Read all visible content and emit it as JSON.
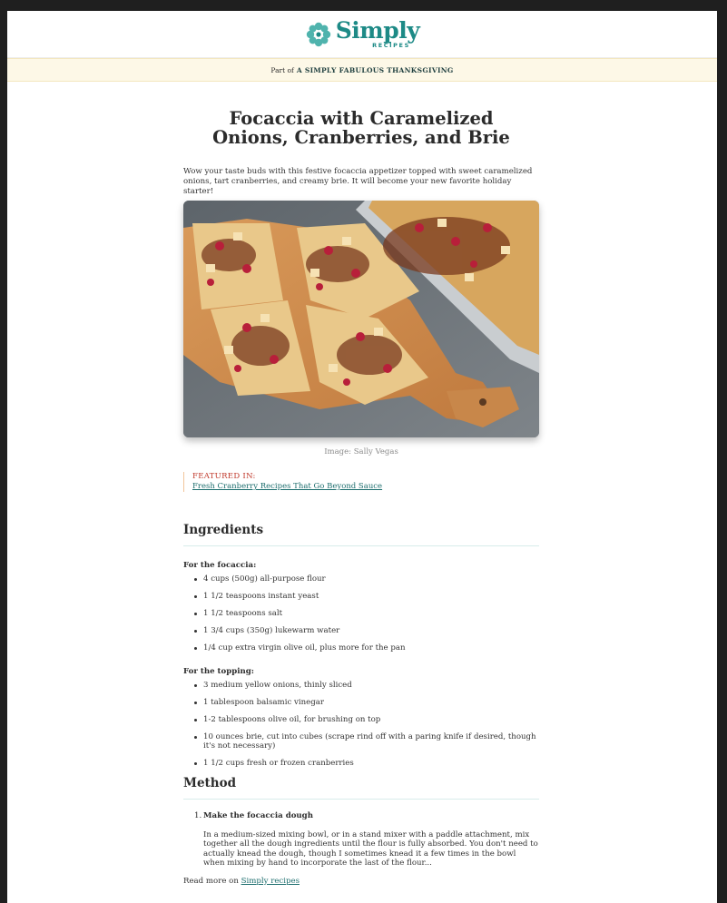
{
  "brand": {
    "name": "Simply",
    "sub": "RECIPES",
    "color": "#1d8a86"
  },
  "banner": {
    "prefix": "Part of",
    "link": "A SIMPLY FABULOUS THANKSGIVING"
  },
  "article": {
    "title": "Focaccia with Caramelized Onions, Cranberries, and Brie",
    "intro": "Wow your taste buds with this festive focaccia appetizer topped with sweet caramelized onions, tart cranberries, and creamy brie. It will become your new favorite holiday starter!",
    "image_credit": "Image: Sally Vegas",
    "featured_label": "FEATURED IN:",
    "featured_link": "Fresh Cranberry Recipes That Go Beyond Sauce"
  },
  "ingredients": {
    "heading": "Ingredients",
    "groups": [
      {
        "title": "For the focaccia:",
        "items": [
          "4 cups (500g) all-purpose flour",
          "1 1/2 teaspoons instant yeast",
          "1 1/2 teaspoons salt",
          "1 3/4 cups (350g) lukewarm water",
          "1/4 cup extra virgin olive oil, plus more for the pan"
        ]
      },
      {
        "title": "For the topping:",
        "items": [
          "3 medium yellow onions, thinly sliced",
          "1 tablespoon balsamic vinegar",
          "1-2 tablespoons olive oil, for brushing on top",
          "10 ounces brie, cut into cubes (scrape rind off with a paring knife if desired, though it's not necessary)",
          "1 1/2 cups fresh or frozen cranberries"
        ]
      }
    ]
  },
  "method": {
    "heading": "Method",
    "steps": [
      {
        "number": "1.",
        "title": "Make the focaccia dough",
        "body": "In a medium-sized mixing bowl, or in a stand mixer with a paddle attachment, mix together all the dough ingredients until the flour is fully absorbed. You don't need to actually knead the dough, though I sometimes knead it a few times in the bowl when mixing by hand to incorporate the last of the flour..."
      }
    ]
  },
  "read_more": {
    "prefix": "Read more on",
    "link": "Simply recipes"
  }
}
